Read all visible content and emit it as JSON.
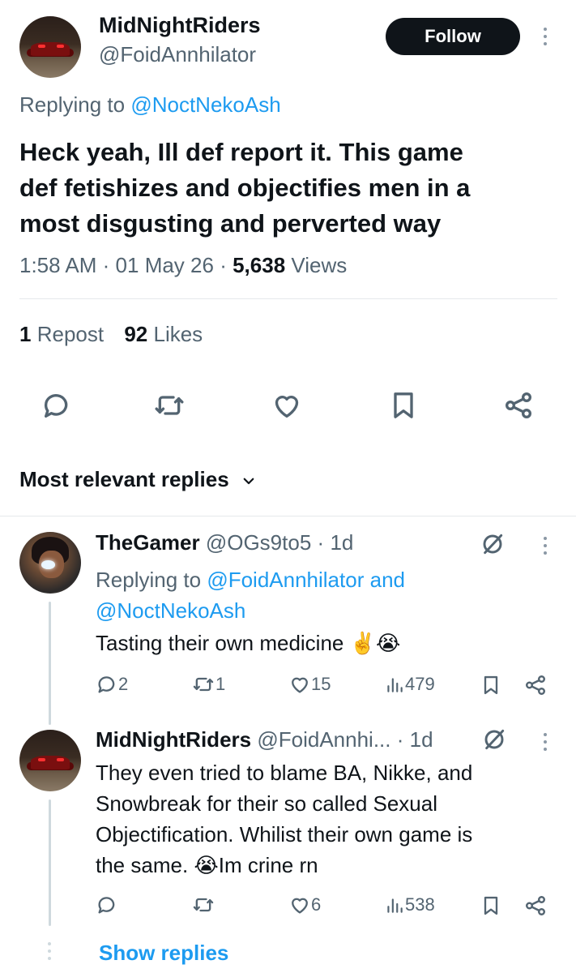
{
  "tweet": {
    "display_name": "MidNightRiders",
    "handle": "@FoidAnnhilator",
    "follow_label": "Follow",
    "replying_prefix": "Replying to",
    "replying_to": "@NoctNekoAsh",
    "text_line1": "Heck yeah, Ill def report it. This game",
    "text_line2": "def fetishizes and objectifies men in a",
    "text_line3": "most disgusting and perverted way",
    "time": "1:58 AM",
    "dot1": "·",
    "date": "01 May 26",
    "dot2": "·",
    "views_count": "5,638",
    "views_label": "Views",
    "reposts_count": "1",
    "reposts_label": "Repost",
    "likes_count": "92",
    "likes_label": "Likes"
  },
  "replies_header": {
    "label": "Most relevant replies",
    "chevron": "⌄"
  },
  "replies": [
    {
      "display_name": "TheGamer",
      "handle": "@OGs9to5",
      "dot": "·",
      "age": "1d",
      "replying_prefix": "Replying to",
      "replying_to_1": "@FoidAnnhilator",
      "and": "and",
      "replying_to_2": "@NoctNekoAsh",
      "text_line1": "Tasting their own medicine ✌️😭",
      "replies_count": "2",
      "reposts_count": "1",
      "likes_count": "15",
      "views_count": "479"
    },
    {
      "display_name": "MidNightRiders",
      "handle": "@FoidAnnhi...",
      "dot": "·",
      "age": "1d",
      "text_line1": "They even tried to blame BA, Nikke, and",
      "text_line2": "Snowbreak for their so called Sexual",
      "text_line3": "Objectification. Whilist their own game is",
      "text_line4": "the same. 😭Im crine rn",
      "replies_count": "",
      "reposts_count": "",
      "likes_count": "6",
      "views_count": "538"
    }
  ],
  "show_replies_label": "Show replies",
  "icons": {
    "reply": "speech-bubble",
    "repost": "repost-arrows",
    "like": "heart",
    "bookmark": "bookmark",
    "share": "share-nodes",
    "views": "bar-chart",
    "grok": "grok-slash-circle",
    "more": "vertical-ellipsis"
  },
  "colors": {
    "text": "#0f1419",
    "muted": "#536471",
    "link": "#1d9bf0",
    "follow_bg": "#0f1419"
  }
}
